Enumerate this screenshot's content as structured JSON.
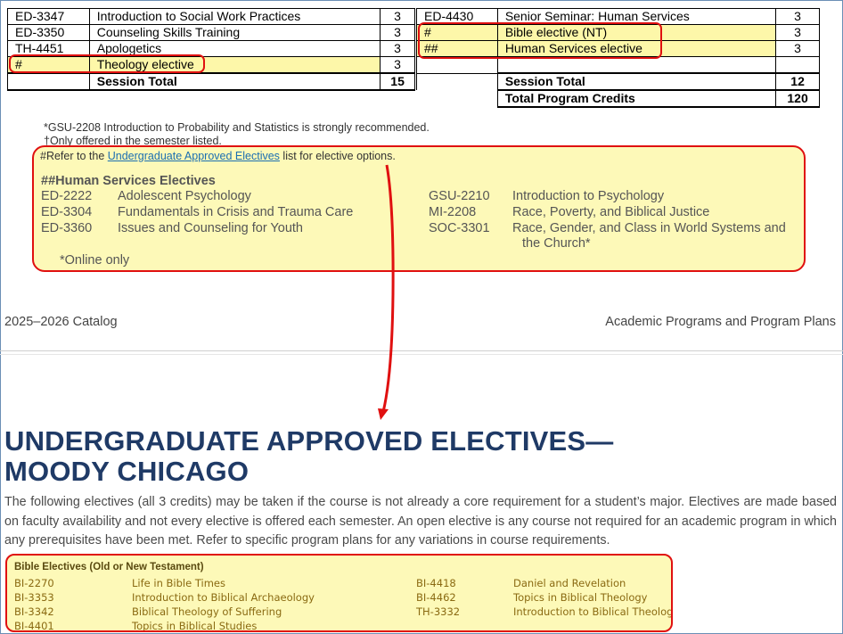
{
  "left_table": {
    "rows": [
      {
        "code": "ED-3347",
        "title": "Introduction to Social Work Practices",
        "credits": "3"
      },
      {
        "code": "ED-3350",
        "title": "Counseling Skills Training",
        "credits": "3"
      },
      {
        "code": "TH-4451",
        "title": "Apologetics",
        "credits": "3"
      },
      {
        "code": "#",
        "title": "Theology elective",
        "credits": "3"
      }
    ],
    "total_label": "Session Total",
    "total_credits": "15"
  },
  "right_table": {
    "rows": [
      {
        "code": "ED-4430",
        "title": "Senior Seminar: Human Services",
        "credits": "3"
      },
      {
        "code": "#",
        "title": "Bible elective (NT)",
        "credits": "3"
      },
      {
        "code": "##",
        "title": "Human Services elective",
        "credits": "3"
      },
      {
        "code": "",
        "title": "",
        "credits": ""
      }
    ],
    "total_label": "Session Total",
    "total_credits": "12",
    "program_label": "Total Program Credits",
    "program_credits": "120"
  },
  "notes": {
    "gsu": "*GSU-2208 Introduction to Probability and Statistics is strongly recommended.",
    "offered": "†Only offered in the semester listed.",
    "refer_prefix": "#Refer to the ",
    "refer_link": "Undergraduate Approved Electives",
    "refer_suffix": " list for elective options."
  },
  "human_services": {
    "title": "##Human Services Electives",
    "left": [
      {
        "code": "ED-2222",
        "title": "Adolescent Psychology"
      },
      {
        "code": "ED-3304",
        "title": "Fundamentals in Crisis and Trauma Care"
      },
      {
        "code": "ED-3360",
        "title": "Issues and Counseling for Youth"
      }
    ],
    "right": [
      {
        "code": "GSU-2210",
        "title": "Introduction to Psychology"
      },
      {
        "code": "MI-2208",
        "title": "Race, Poverty, and Biblical Justice"
      },
      {
        "code": "SOC-3301",
        "title": "Race, Gender, and Class in World Systems and",
        "title2": "the Church*"
      }
    ],
    "online_note": "*Online only"
  },
  "footer": {
    "left": "2025–2026 Catalog",
    "right": "Academic Programs and Program Plans"
  },
  "section": {
    "title_line1": "UNDERGRADUATE APPROVED ELECTIVES—",
    "title_line2": "MOODY CHICAGO",
    "paragraph": "The following electives (all 3 credits) may be taken if the course is not already a core requirement for a student’s major. Electives are made based on faculty availability and not every elective is offered each semester. An open elective is any course not required for an academic program in which any prerequisites have been met. Refer to specific program plans for any variations in course requirements."
  },
  "bible_electives": {
    "title": "Bible Electives (Old or New Testament)",
    "left": [
      {
        "code": "BI-2270",
        "title": "Life in Bible Times"
      },
      {
        "code": "BI-3353",
        "title": "Introduction to Biblical Archaeology"
      },
      {
        "code": "BI-3342",
        "title": "Biblical Theology of Suffering"
      },
      {
        "code": "BI-4401",
        "title": "Topics in Biblical Studies"
      }
    ],
    "right": [
      {
        "code": "BI-4418",
        "title": "Daniel and Revelation"
      },
      {
        "code": "BI-4462",
        "title": "Topics in Biblical Theology"
      },
      {
        "code": "TH-3332",
        "title": "Introduction to Biblical Theology"
      }
    ]
  },
  "colors": {
    "highlight": "#fdf9b8",
    "annotation_red": "#e01010",
    "title_navy": "#1f3a66",
    "link_blue": "#1b6fb1"
  }
}
